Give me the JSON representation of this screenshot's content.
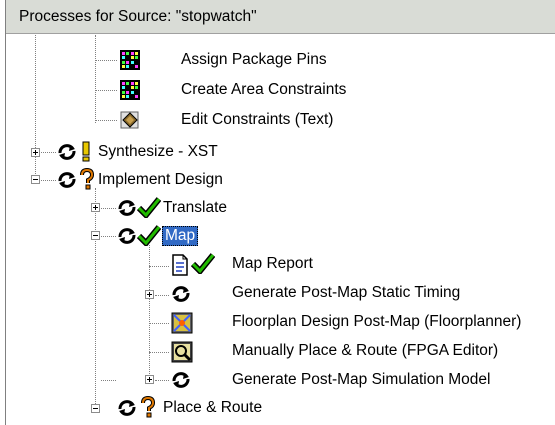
{
  "header": {
    "title": "Processes for Source: \"stopwatch\""
  },
  "tree": {
    "assign_pins": "Assign Package Pins",
    "create_area": "Create Area Constraints",
    "edit_constraints": "Edit Constraints (Text)",
    "synthesize": "Synthesize - XST",
    "implement": "Implement Design",
    "translate": "Translate",
    "map": "Map",
    "map_report": "Map Report",
    "gen_static_timing": "Generate Post-Map Static Timing",
    "floorplan": "Floorplan Design Post-Map (Floorplanner)",
    "manual_place": "Manually Place & Route (FPGA Editor)",
    "gen_sim_model": "Generate Post-Map Simulation Model",
    "place_route": "Place & Route"
  },
  "status_colors": {
    "ok": "#22aa00",
    "warning": "#e0c000",
    "question": "#d07000",
    "selected": "#316ac5"
  }
}
